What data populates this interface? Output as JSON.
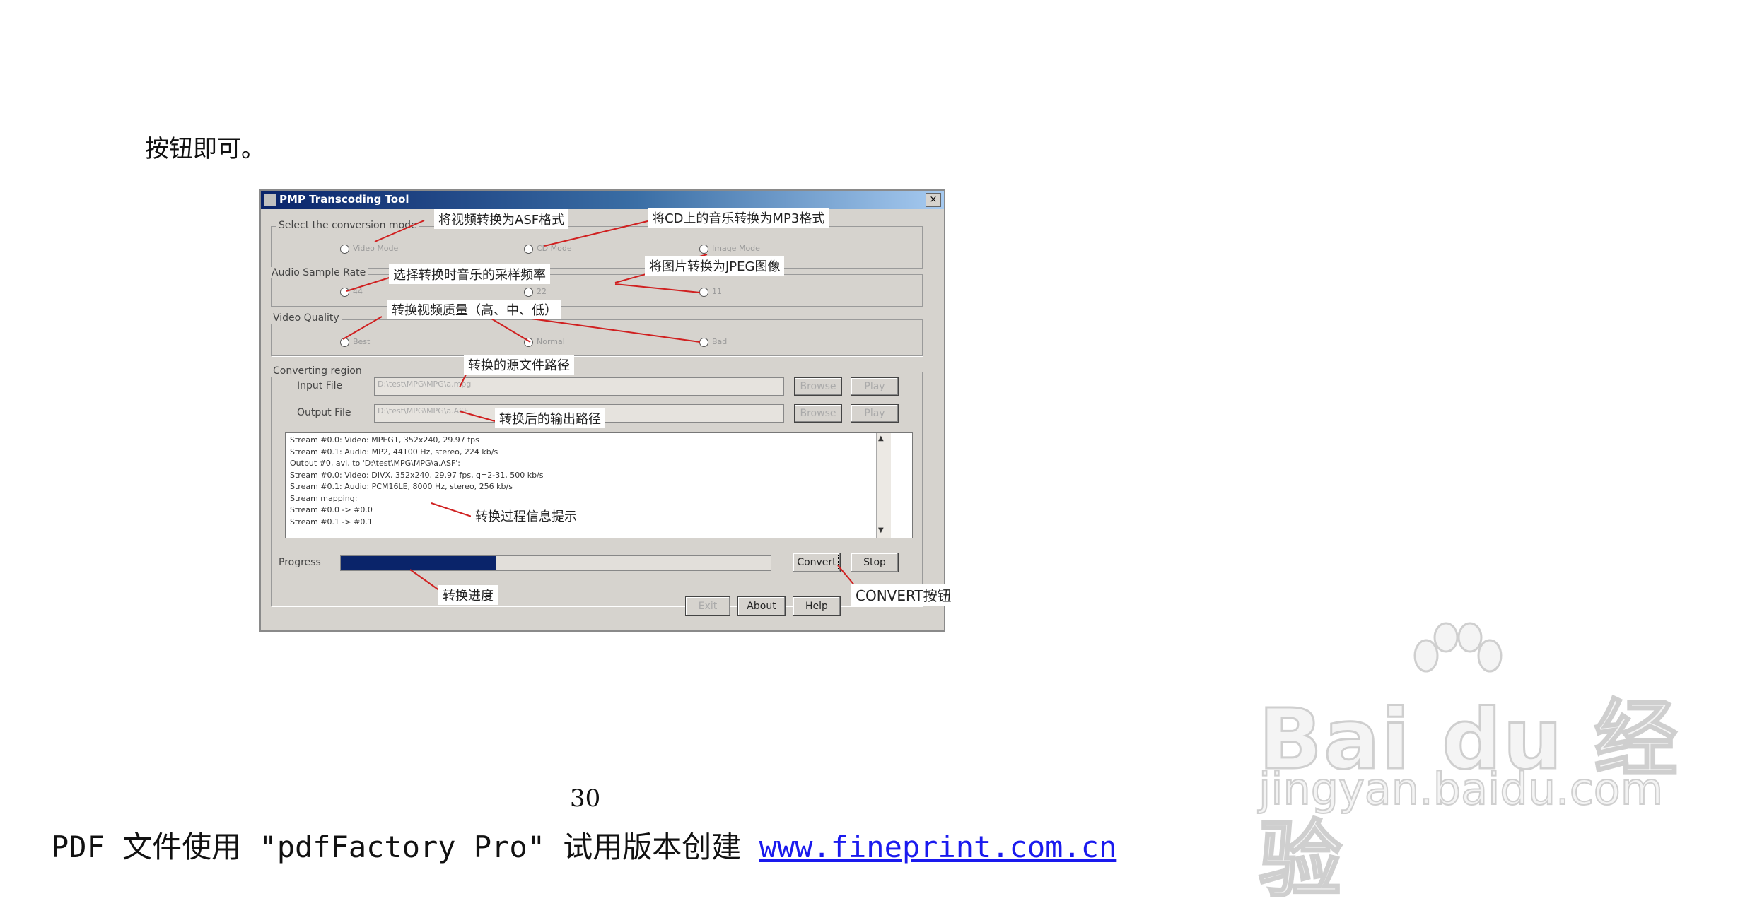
{
  "document": {
    "intro_text": "按钮即可。",
    "page_number": "30",
    "footer": {
      "prefix": "PDF 文件使用 \"pdfFactory Pro\" 试用版本创建 ",
      "link": "www.fineprint.com.cn"
    }
  },
  "dialog": {
    "title": "PMP Transcoding Tool",
    "close_label": "×",
    "conversion_mode": {
      "label": "Select the conversion mode",
      "options": [
        "Video Mode",
        "CD Mode",
        "Image Mode"
      ]
    },
    "audio_sample_rate": {
      "label": "Audio Sample Rate",
      "options": [
        "44",
        "22",
        "11"
      ]
    },
    "video_quality": {
      "label": "Video Quality",
      "options": [
        "Best",
        "Normal",
        "Bad"
      ]
    },
    "converting_region": {
      "label": "Converting region",
      "input_label": "Input File",
      "input_value": "D:\\test\\MPG\\MPG\\a.mpg",
      "output_label": "Output File",
      "output_value": "D:\\test\\MPG\\MPG\\a.ASF",
      "browse_label": "Browse",
      "play_label": "Play"
    },
    "log_lines": [
      "Stream #0.0: Video: MPEG1, 352x240, 29.97 fps",
      "Stream #0.1: Audio: MP2, 44100 Hz, stereo, 224 kb/s",
      "Output #0, avi, to 'D:\\test\\MPG\\MPG\\a.ASF':",
      "Stream #0.0: Video: DIVX, 352x240, 29.97 fps, q=2-31, 500 kb/s",
      "Stream #0.1: Audio: PCM16LE, 8000 Hz, stereo, 256 kb/s",
      "Stream mapping:",
      "Stream #0.0 -> #0.0",
      "Stream #0.1 -> #0.1"
    ],
    "progress_label": "Progress",
    "progress_fraction": 0.36,
    "convert_label": "Convert",
    "stop_label": "Stop",
    "exit_label": "Exit",
    "about_label": "About",
    "help_label": "Help"
  },
  "annotations": {
    "to_asf": "将视频转换为ASF格式",
    "cd_to_mp3": "将CD上的音乐转换为MP3格式",
    "image_to_jpeg": "将图片转换为JPEG图像",
    "sample_rate": "选择转换时音乐的采样频率",
    "video_quality": "转换视频质量（高、中、低）",
    "source_path": "转换的源文件路径",
    "output_path": "转换后的输出路径",
    "process_info": "转换过程信息提示",
    "progress": "转换进度",
    "convert_button": "CONVERT按钮"
  },
  "watermark": {
    "brand": "Bai du 经验",
    "domain": "jingyan.baidu.com"
  },
  "colors": {
    "annotation_line": "#d02020",
    "progress_fill": "#0a246a",
    "link": "#1a1aee"
  }
}
